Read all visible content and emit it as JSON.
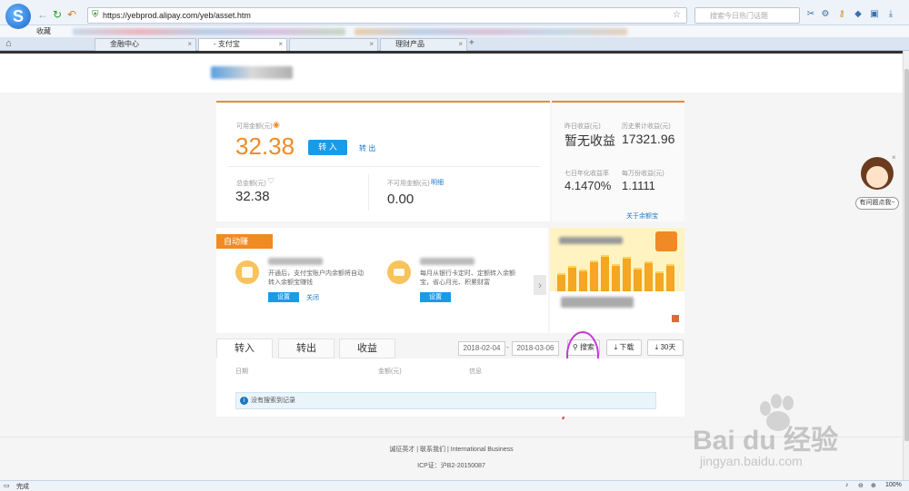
{
  "browser": {
    "url": "https://yebprod.alipay.com/yeb/asset.htm",
    "search_placeholder": "搜索今日热门话题",
    "favorites_label": "收藏",
    "tabs": [
      {
        "label": "金融中心"
      },
      {
        "label": "- 支付宝"
      },
      {
        "label": ""
      },
      {
        "label": "理财产品"
      }
    ],
    "status_left": "完成",
    "zoom": "100%"
  },
  "available": {
    "label": "可用金额(元)",
    "amount": "32.38",
    "transfer_in": "转 入",
    "transfer_out": "转 出"
  },
  "total": {
    "label": "总金额(元)",
    "amount": "32.38"
  },
  "unavailable": {
    "label": "不可用金额(元)",
    "detail": "明细",
    "amount": "0.00"
  },
  "earnings": {
    "yesterday_label": "昨日收益(元)",
    "yesterday_value": "暂无收益",
    "cumulative_label": "历史累计收益(元)",
    "cumulative_value": "17321.96",
    "seven_day_label": "七日年化收益率",
    "seven_day_value": "4.1470%",
    "per_10k_label": "每万份收益(元)",
    "per_10k_value": "1.1111",
    "about_link": "关于余额宝"
  },
  "auto_earn": {
    "badge": "自动赚",
    "item1_text": "开通后，支付宝账户内余额将自动转入余额宝赚钱",
    "item1_setup": "设置",
    "item1_close": "关闭",
    "item2_text": "每月从银行卡定时、定额转入余额宝，省心月光、积累财富",
    "item2_setup": "设置"
  },
  "records": {
    "tabs": [
      "转入",
      "转出",
      "收益"
    ],
    "date_from": "2018-02-04",
    "date_sep": "-",
    "date_to": "2018-03-06",
    "search": "搜索",
    "download": "下载",
    "last30": "30天",
    "columns": [
      "日期",
      "金额(元)",
      "信息"
    ],
    "empty": "没有搜索到记录"
  },
  "footer": {
    "links": "诚征英才 | 联系我们 | International Business",
    "icp": "ICP证：沪B2-20150087"
  },
  "assistant": {
    "label": "有问题点我~"
  },
  "watermark": {
    "brand": "Bai du 经验",
    "url": "jingyan.baidu.com"
  },
  "colors": {
    "accent": "#f08a24",
    "primary_blue": "#1a9be6",
    "annotation": "#c23ad4"
  }
}
